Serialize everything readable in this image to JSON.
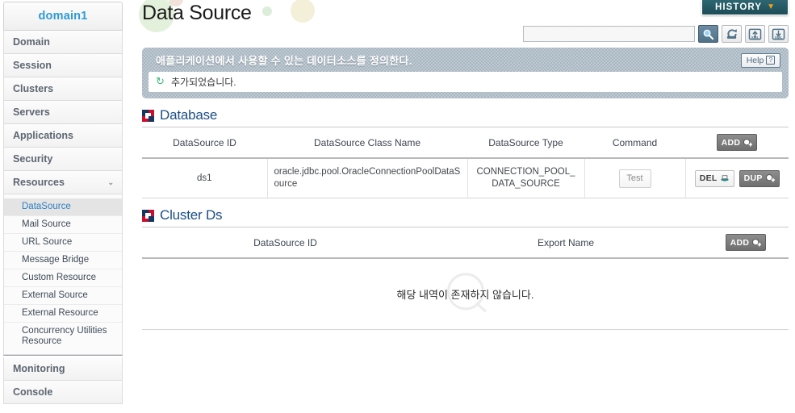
{
  "sidebar": {
    "domain_label": "domain1",
    "nav": [
      {
        "label": "Domain"
      },
      {
        "label": "Session"
      },
      {
        "label": "Clusters"
      },
      {
        "label": "Servers"
      },
      {
        "label": "Applications"
      },
      {
        "label": "Security"
      },
      {
        "label": "Resources",
        "expanded": true,
        "chevron": "⌄"
      }
    ],
    "resources_children": [
      {
        "label": "DataSource",
        "active": true
      },
      {
        "label": "Mail Source",
        "active": false
      },
      {
        "label": "URL Source",
        "active": false
      },
      {
        "label": "Message Bridge",
        "active": false
      },
      {
        "label": "Custom Resource",
        "active": false
      },
      {
        "label": "External Source",
        "active": false
      },
      {
        "label": "External Resource",
        "active": false
      },
      {
        "label": "Concurrency Utilities Resource",
        "active": false
      }
    ],
    "footer_nav": [
      {
        "label": "Monitoring"
      },
      {
        "label": "Console"
      }
    ]
  },
  "header": {
    "page_title": "Data Source",
    "history_label": "HISTORY",
    "history_arrow": "▼"
  },
  "toolbar": {
    "search_value": "",
    "search_placeholder": "",
    "buttons": [
      {
        "name": "search-icon",
        "label": ""
      },
      {
        "name": "refresh-icon",
        "label": ""
      },
      {
        "name": "xml-upload-icon",
        "label": ""
      },
      {
        "name": "xml-download-icon",
        "label": ""
      }
    ]
  },
  "banner": {
    "description": "애플리케이션에서 사용할 수 있는 데이터소스를 정의한다.",
    "help_label": "Help",
    "help_mark": "?",
    "status_message": "추가되었습니다.",
    "status_icon": "↻"
  },
  "database_section": {
    "title": "Database",
    "columns": [
      "DataSource ID",
      "DataSource Class Name",
      "DataSource Type",
      "Command",
      ""
    ],
    "add_label": "ADD",
    "rows": [
      {
        "datasource_id": "ds1",
        "class_name": "oracle.jdbc.pool.OracleConnectionPoolDataSource",
        "type": "CONNECTION_POOL_DATA_SOURCE",
        "command_label": "Test",
        "del_label": "DEL",
        "dup_label": "DUP"
      }
    ]
  },
  "cluster_ds_section": {
    "title": "Cluster Ds",
    "columns": [
      "DataSource ID",
      "Export Name",
      ""
    ],
    "add_label": "ADD",
    "empty_message": "해당 내역이 존재하지 않습니다."
  },
  "colors": {
    "brand_blue": "#2e9ad6",
    "section_title": "#1b4f86",
    "history_bg": "#1d4c57",
    "history_arrow": "#f0a020",
    "banner_bg": "#a9b7c2",
    "accent_red": "#c8102e",
    "accent_navy": "#14365f",
    "status_green": "#3cb878"
  }
}
